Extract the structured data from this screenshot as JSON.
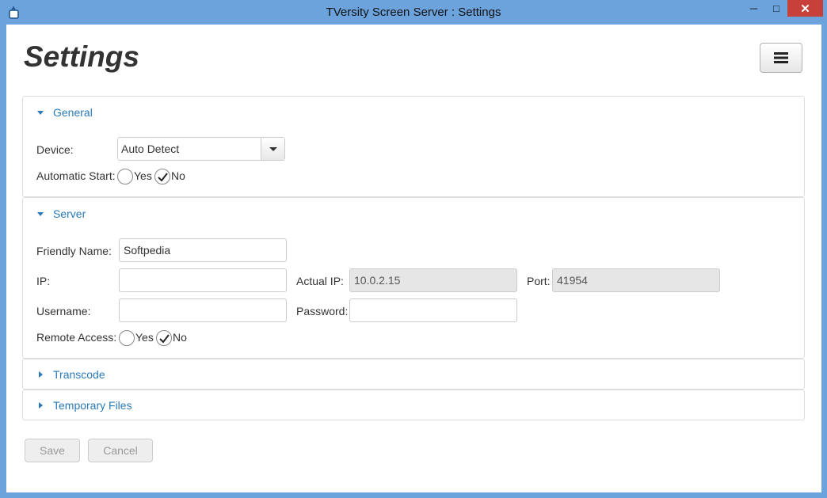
{
  "window": {
    "title": "TVersity Screen Server : Settings",
    "controls": {
      "minimize": "─",
      "maximize": "□",
      "close": "✕"
    }
  },
  "page": {
    "title": "Settings",
    "menu_icon": "hamburger-icon"
  },
  "sections": {
    "general": {
      "title": "General",
      "expanded": true,
      "device_label": "Device:",
      "device_value": "Auto Detect",
      "auto_start_label": "Automatic Start:",
      "yes_label": "Yes",
      "no_label": "No",
      "auto_start_selected": "No"
    },
    "server": {
      "title": "Server",
      "expanded": true,
      "friendly_name_label": "Friendly Name:",
      "friendly_name_value": "Softpedia",
      "ip_label": "IP:",
      "ip_value": "",
      "actual_ip_label": "Actual IP:",
      "actual_ip_value": "10.0.2.15",
      "port_label": "Port:",
      "port_value": "41954",
      "username_label": "Username:",
      "username_value": "",
      "password_label": "Password:",
      "password_value": "",
      "remote_access_label": "Remote Access:",
      "yes_label": "Yes",
      "no_label": "No",
      "remote_access_selected": "No"
    },
    "transcode": {
      "title": "Transcode",
      "expanded": false
    },
    "temporary_files": {
      "title": "Temporary Files",
      "expanded": false
    }
  },
  "actions": {
    "save_label": "Save",
    "cancel_label": "Cancel"
  },
  "colors": {
    "titlebar": "#6ca3dd",
    "close": "#c7403a",
    "link": "#2a7ab8"
  }
}
